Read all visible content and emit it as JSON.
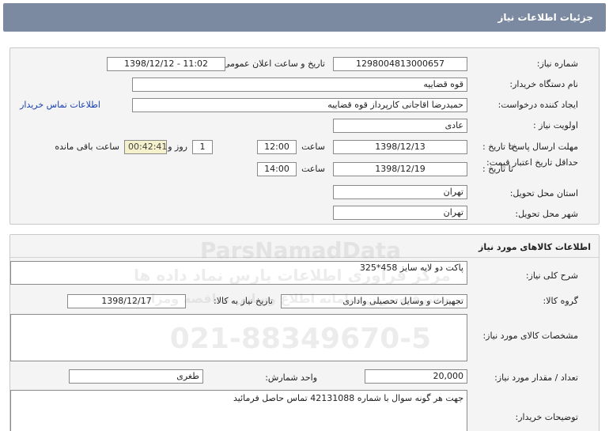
{
  "header": {
    "title": "جزئیات اطلاعات نیاز"
  },
  "need_info": {
    "need_number_label": "شماره نیاز:",
    "need_number": "1298004813000657",
    "announce_label": "تاریخ و ساعت اعلان عمومی:",
    "announce_value": "1398/12/12 - 11:02",
    "buyer_org_label": "نام دستگاه خریدار:",
    "buyer_org": "قوه قضاییه",
    "creator_label": "ایجاد کننده درخواست:",
    "creator": "حمیدرضا اقاجانی کارپرداز قوه قضاییه",
    "contact_link": "اطلاعات تماس خریدار",
    "priority_label": "اولویت نیاز :",
    "priority": "عادی",
    "deadline_label": "مهلت ارسال پاسخ:",
    "to_date_label": "تا تاریخ :",
    "deadline_date": "1398/12/13",
    "time_label": "ساعت",
    "deadline_time": "12:00",
    "days_value": "1",
    "days_label": "روز و",
    "remaining_time": "00:42:41",
    "remaining_label": "ساعت باقی مانده",
    "validity_label": "حداقل تاریخ اعتبار قیمت:",
    "validity_date": "1398/12/19",
    "validity_time": "14:00",
    "province_label": "استان محل تحویل:",
    "province": "تهران",
    "city_label": "شهر محل تحویل:",
    "city": "تهران"
  },
  "goods": {
    "section_title": "اطلاعات کالاهای مورد نیاز",
    "desc_label": "شرح کلی نیاز:",
    "desc": "پاکت دو لایه سایز 458*325",
    "group_label": "گروه کالا:",
    "group": "تجهیزات و وسایل تحصیلی واداری",
    "need_date_label": "تاریخ نیاز به کالا:",
    "need_date": "1398/12/17",
    "specs_label": "مشخصات کالای مورد نیاز:",
    "specs": "",
    "qty_label": "تعداد / مقدار مورد نیاز:",
    "qty": "20,000",
    "unit_label": "واحد شمارش:",
    "unit": "طغری",
    "buyer_notes_label": "توضیحات خریدار:",
    "buyer_notes": "جهت هر گونه سوال با شماره 42131088 تماس حاصل فرمائید"
  },
  "watermark": {
    "line1": "ParsNamadData",
    "line2": "مرکز فراوری اطلاعات پارس نماد داده ها",
    "line3": "پیشرفته ترین سامانه اطلاع رسانی مناقصه ومزایده",
    "line4": "021-88349670-5"
  }
}
